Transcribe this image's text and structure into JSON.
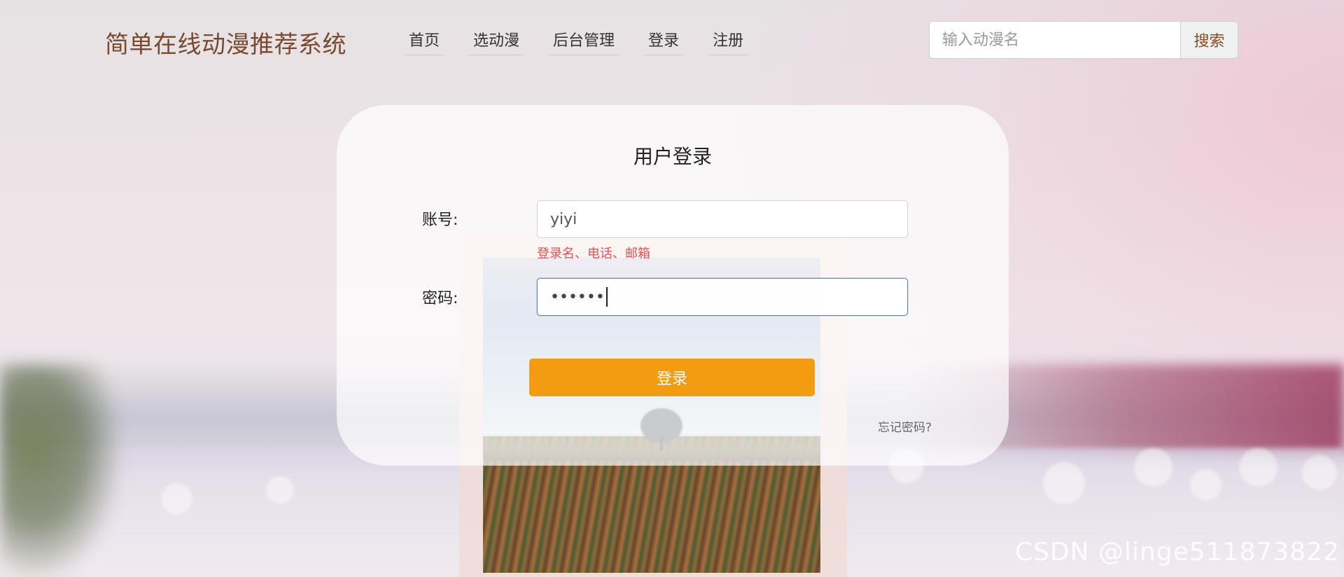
{
  "header": {
    "brand": "简单在线动漫推荐系统",
    "nav": [
      "首页",
      "选动漫",
      "后台管理",
      "登录",
      "注册"
    ],
    "search": {
      "placeholder": "输入动漫名",
      "button_label": "搜索"
    }
  },
  "login": {
    "title": "用户登录",
    "account_label": "账号:",
    "account_value": "yiyi",
    "account_hint": "登录名、电话、邮箱",
    "password_label": "密码:",
    "password_value": "••••••",
    "submit_label": "登录",
    "forgot_label": "忘记密码?"
  },
  "watermark": "CSDN @linge511873822",
  "colors": {
    "accent": "#f39c12",
    "brand": "#7a4a2e",
    "hint": "#e2524f"
  }
}
